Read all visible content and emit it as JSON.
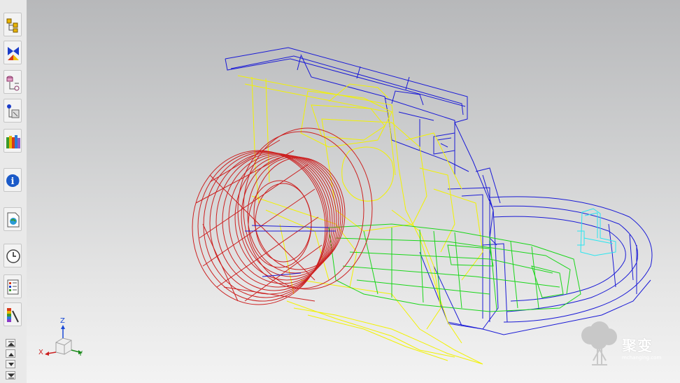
{
  "toolbar": {
    "tools": [
      {
        "name": "assembly-navigator",
        "icon": "assembly-icon"
      },
      {
        "name": "constraint-navigator",
        "icon": "constraint-icon"
      },
      {
        "name": "part-navigator",
        "icon": "part-tree-icon"
      },
      {
        "name": "reuse-library",
        "icon": "reuse-library-icon"
      },
      {
        "name": "history-palette",
        "icon": "books-icon"
      },
      {
        "name": "information",
        "icon": "info-icon"
      },
      {
        "name": "web-browser",
        "icon": "globe-page-icon"
      },
      {
        "name": "history",
        "icon": "clock-icon"
      },
      {
        "name": "process-studio",
        "icon": "list-icon"
      },
      {
        "name": "roles",
        "icon": "palette-icon"
      }
    ],
    "scroll_buttons": [
      "scroll-up-end",
      "scroll-up",
      "scroll-down",
      "scroll-down-end"
    ]
  },
  "triad": {
    "x_label": "X",
    "y_label": "Y",
    "z_label": "Z"
  },
  "watermark": {
    "text": "聚变",
    "url": "mchanging.com"
  },
  "colors": {
    "blue": "#1a1ad6",
    "yellow": "#f2f200",
    "red": "#cc2020",
    "green": "#19d619",
    "cyan": "#28e6f0"
  }
}
